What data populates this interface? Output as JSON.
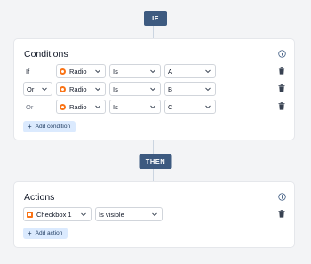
{
  "if_label": "IF",
  "then_label": "THEN",
  "conditions": {
    "title": "Conditions",
    "rows": [
      {
        "connector": "If",
        "connector_is_select": false,
        "field": "Radio",
        "operator": "Is",
        "value": "A"
      },
      {
        "connector": "Or",
        "connector_is_select": true,
        "field": "Radio",
        "operator": "Is",
        "value": "B"
      },
      {
        "connector": "Or",
        "connector_is_select": false,
        "field": "Radio",
        "operator": "Is",
        "value": "C"
      }
    ],
    "add_label": "Add condition"
  },
  "actions": {
    "title": "Actions",
    "rows": [
      {
        "field": "Checkbox 1",
        "operator": "Is visible"
      }
    ],
    "add_label": "Add action"
  },
  "colors": {
    "pill": "#3d5a80",
    "field_icon": "#f97316",
    "add_button_bg": "#dbeafe"
  },
  "icons": {
    "info": "info-icon",
    "chevron": "chevron-down-icon",
    "trash": "trash-icon",
    "plus": "plus-icon",
    "radio": "radio-field-icon",
    "checkbox": "checkbox-field-icon"
  }
}
